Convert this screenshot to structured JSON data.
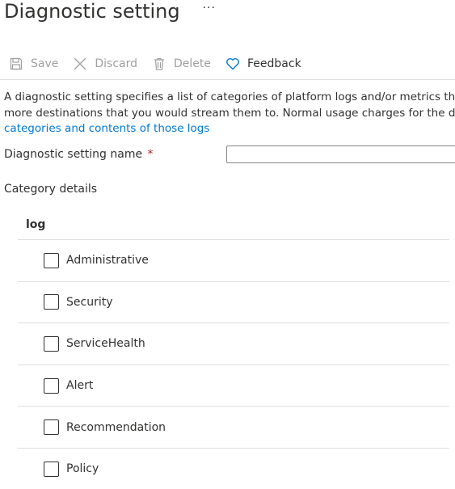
{
  "header": {
    "title": "Diagnostic setting",
    "more": "···"
  },
  "toolbar": {
    "save_label": "Save",
    "discard_label": "Discard",
    "delete_label": "Delete",
    "feedback_label": "Feedback",
    "icons": [
      "save-icon",
      "discard-icon",
      "delete-icon",
      "heart-icon"
    ]
  },
  "description": {
    "line1": "A diagnostic setting specifies a list of categories of platform logs and/or metrics that you",
    "line2": "more destinations that you would stream them to. Normal usage charges for the destina",
    "link": "categories and contents of those logs"
  },
  "name_field": {
    "label": "Diagnostic setting name",
    "required_mark": "*",
    "value": ""
  },
  "category": {
    "label": "Category details",
    "log_header": "log",
    "items": [
      {
        "label": "Administrative",
        "checked": false
      },
      {
        "label": "Security",
        "checked": false
      },
      {
        "label": "ServiceHealth",
        "checked": false
      },
      {
        "label": "Alert",
        "checked": false
      },
      {
        "label": "Recommendation",
        "checked": false
      },
      {
        "label": "Policy",
        "checked": false
      }
    ]
  },
  "colors": {
    "link": "#0078d4",
    "required": "#a4262c",
    "disabled_text": "#a19f9d",
    "accent": "#0078d4"
  }
}
